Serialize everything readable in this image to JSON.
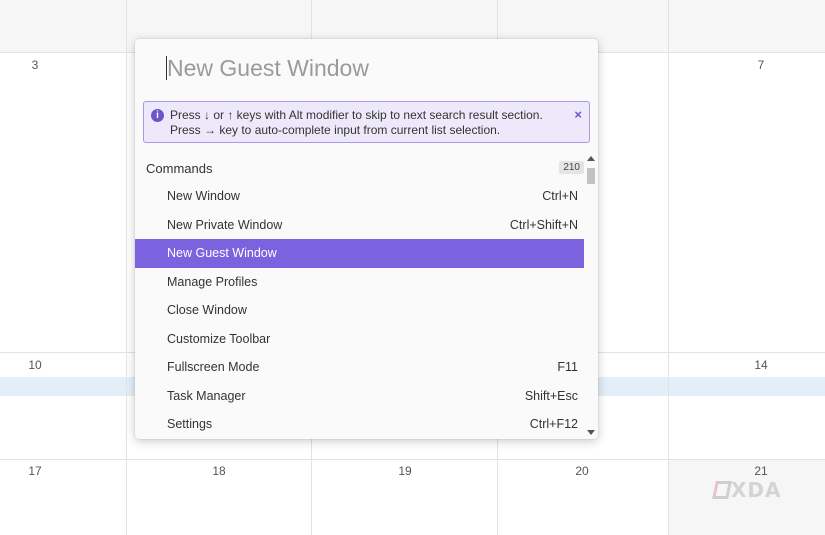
{
  "calendar": {
    "days": [
      "3",
      "7",
      "10",
      "14",
      "17",
      "18",
      "19",
      "20",
      "21"
    ]
  },
  "palette": {
    "search": {
      "value": "New Guest Window"
    },
    "info": {
      "icon": "info-icon",
      "text": "Press ↓ or ↑ keys with Alt modifier to skip to next search result section. Press → key to auto-complete input from current list selection.",
      "close": "×"
    },
    "section": {
      "title": "Commands",
      "count": "210"
    },
    "items": [
      {
        "label": "New Window",
        "shortcut": "Ctrl+N"
      },
      {
        "label": "New Private Window",
        "shortcut": "Ctrl+Shift+N"
      },
      {
        "label": "New Guest Window",
        "shortcut": ""
      },
      {
        "label": "Manage Profiles",
        "shortcut": ""
      },
      {
        "label": "Close Window",
        "shortcut": ""
      },
      {
        "label": "Customize Toolbar",
        "shortcut": ""
      },
      {
        "label": "Fullscreen Mode",
        "shortcut": "F11"
      },
      {
        "label": "Task Manager",
        "shortcut": "Shift+Esc"
      },
      {
        "label": "Settings",
        "shortcut": "Ctrl+F12"
      }
    ],
    "selected_index": 2,
    "colors": {
      "accent": "#7b63e0",
      "info_bg": "#ede9fa",
      "info_border": "#a999e6"
    }
  },
  "watermark": {
    "logo": "XDA"
  }
}
